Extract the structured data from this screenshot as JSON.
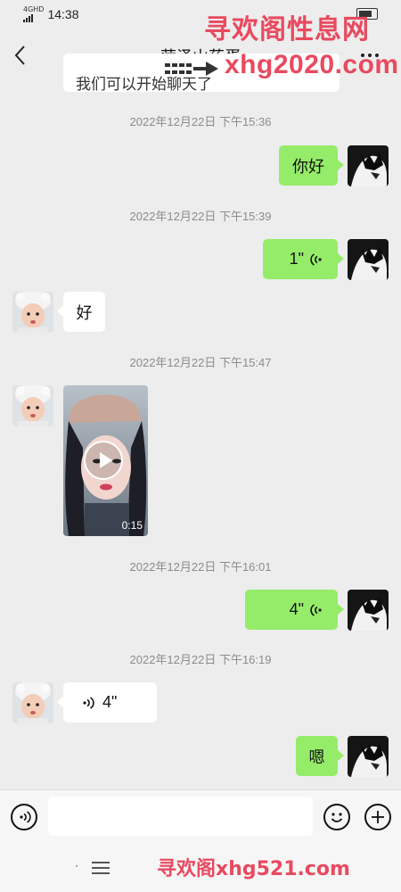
{
  "status_bar": {
    "network": "4GHD",
    "time": "14:38"
  },
  "header": {
    "title": "菏泽山药蛋",
    "more_label": "..."
  },
  "watermarks": {
    "top_cn": "寻欢阁性息网",
    "top_url": "xhg2020.com",
    "bottom": "寻欢阁xhg521.com"
  },
  "messages": {
    "partial_text": "我们可以开始聊天了",
    "ts1": "2022年12月22日 下午15:36",
    "msg1": "你好",
    "ts2": "2022年12月22日 下午15:39",
    "voice1": "1\"",
    "msg2": "好",
    "ts3": "2022年12月22日 下午15:47",
    "video_duration": "0:15",
    "ts4": "2022年12月22日 下午16:01",
    "voice2": "4\"",
    "ts5": "2022年12月22日 下午16:19",
    "voice3": "4\"",
    "msg3": "嗯"
  },
  "input": {
    "placeholder": ""
  },
  "colors": {
    "my_bubble": "#95ec69",
    "their_bubble": "#ffffff",
    "background": "#ededed",
    "watermark": "#e84a5f"
  },
  "icons": {
    "back": "back-chevron-icon",
    "more": "more-dots-icon",
    "voice_toggle": "voice-input-icon",
    "emoji": "emoji-icon",
    "plus": "plus-icon",
    "voice_wave": "voice-wave-icon",
    "play": "play-icon",
    "menu": "menu-icon"
  }
}
